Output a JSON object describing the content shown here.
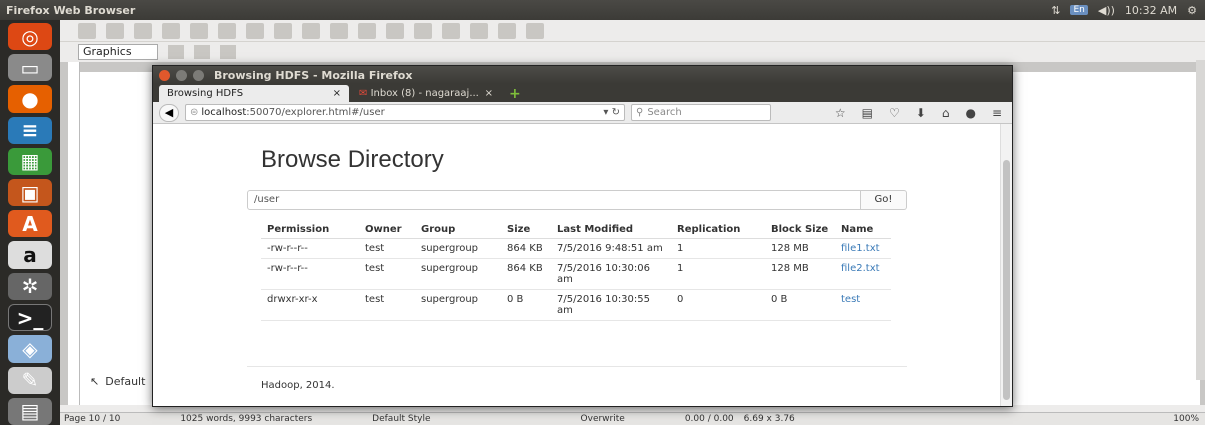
{
  "topbar": {
    "app_title": "Firefox Web Browser",
    "kbd": "En",
    "volume": "◀))",
    "clock": "10:32 AM",
    "gear": "⚙"
  },
  "writer": {
    "style_value": "Graphics",
    "bottom_style": "Default",
    "status": {
      "page": "Page 10 / 10",
      "words": "1025 words, 9993 characters",
      "style": "Default Style",
      "mode": "Overwrite",
      "position": "0.00 / 0.00",
      "size": "6.69 x 3.76",
      "zoom": "100%"
    }
  },
  "firefox": {
    "window_title": "Browsing HDFS - Mozilla Firefox",
    "tabs": [
      {
        "label": "Browsing HDFS",
        "close": "×"
      },
      {
        "label": "Inbox (8) - nagaraaj...",
        "close": "×"
      }
    ],
    "newtab": "+",
    "url_host": "localhost",
    "url_rest": ":50070/explorer.html#/user",
    "search_placeholder": "Search"
  },
  "page": {
    "heading": "Browse Directory",
    "path_value": "/user",
    "go_label": "Go!",
    "columns": [
      "Permission",
      "Owner",
      "Group",
      "Size",
      "Last Modified",
      "Replication",
      "Block Size",
      "Name"
    ],
    "rows": [
      [
        "-rw-r--r--",
        "test",
        "supergroup",
        "864 KB",
        "7/5/2016 9:48:51 am",
        "1",
        "128 MB",
        "file1.txt"
      ],
      [
        "-rw-r--r--",
        "test",
        "supergroup",
        "864 KB",
        "7/5/2016 10:30:06 am",
        "1",
        "128 MB",
        "file2.txt"
      ],
      [
        "drwxr-xr-x",
        "test",
        "supergroup",
        "0 B",
        "7/5/2016 10:30:55 am",
        "0",
        "0 B",
        "test"
      ]
    ],
    "footer": "Hadoop, 2014."
  },
  "colors": {
    "accent": "#3a7ab7",
    "titlebar": "#3b3a36",
    "launcher": "#2b2a27"
  }
}
